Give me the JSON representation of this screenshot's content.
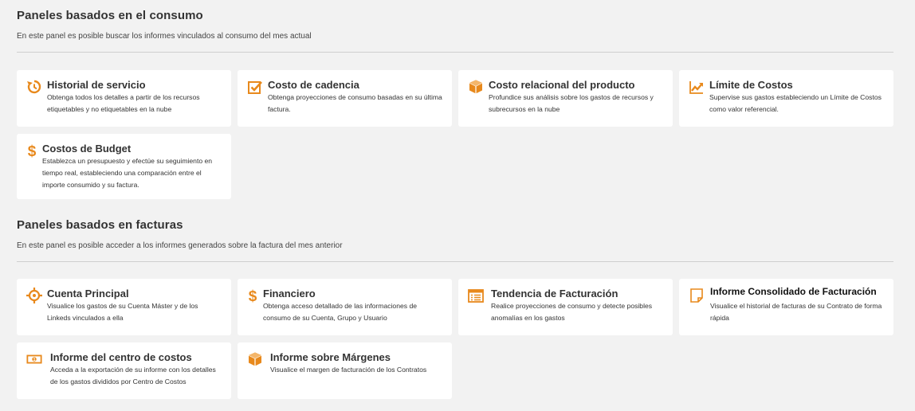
{
  "consumo": {
    "title": "Paneles basados en el consumo",
    "description": "En este panel es posible buscar los informes vinculados al consumo del mes actual",
    "cards": [
      {
        "title": "Historial de servicio",
        "description": "Obtenga todos los detalles a partir de los recursos etiquetables y no etiquetables en la nube",
        "icon": "history-icon"
      },
      {
        "title": "Costo de cadencia",
        "description": "Obtenga proyecciones de consumo basadas en su última factura.",
        "icon": "checkbox-icon"
      },
      {
        "title": "Costo relacional del producto",
        "description": "Profundice sus análisis sobre los gastos de recursos y subrecursos en la nube",
        "icon": "cube-icon"
      },
      {
        "title": "Límite de Costos",
        "description": "Supervise sus gastos estableciendo un Límite de Costos como valor referencial.",
        "icon": "trend-up-icon"
      },
      {
        "title": "Costos de Budget",
        "description": "Establezca un presupuesto y efectúe su seguimiento en tiempo real, estableciendo una comparación entre el importe consumido y su factura.",
        "icon": "dollar-icon"
      }
    ]
  },
  "facturas": {
    "title": "Paneles basados en facturas",
    "description": "En este panel es posible acceder a los informes generados sobre la factura del mes anterior",
    "cards": [
      {
        "title": "Cuenta Principal",
        "description": "Visualice los gastos de su Cuenta Máster y de los Linkeds vinculados a ella",
        "icon": "crosshair-icon"
      },
      {
        "title": "Financiero",
        "description": "Obtenga acceso detallado de las informaciones de consumo de su Cuenta, Grupo y Usuario",
        "icon": "dollar-icon"
      },
      {
        "title": "Tendencia de Facturación",
        "description": "Realice proyecciones de consumo y detecte posibles anomalías en los gastos",
        "icon": "list-icon"
      },
      {
        "title": "Informe Consolidado de Facturación",
        "description": "Visualice el historial de facturas de su Contrato de forma rápida",
        "icon": "note-icon"
      },
      {
        "title": "Informe del centro de costos",
        "description": "Acceda a la exportación de su informe con los detalles de los gastos divididos por Centro de Costos",
        "icon": "money-icon"
      },
      {
        "title": "Informe sobre Márgenes",
        "description": "Visualice el margen de facturación de los Contratos",
        "icon": "cube-icon"
      }
    ]
  },
  "colors": {
    "accent": "#e8891c",
    "background": "#f2f2f2",
    "card": "#ffffff"
  }
}
